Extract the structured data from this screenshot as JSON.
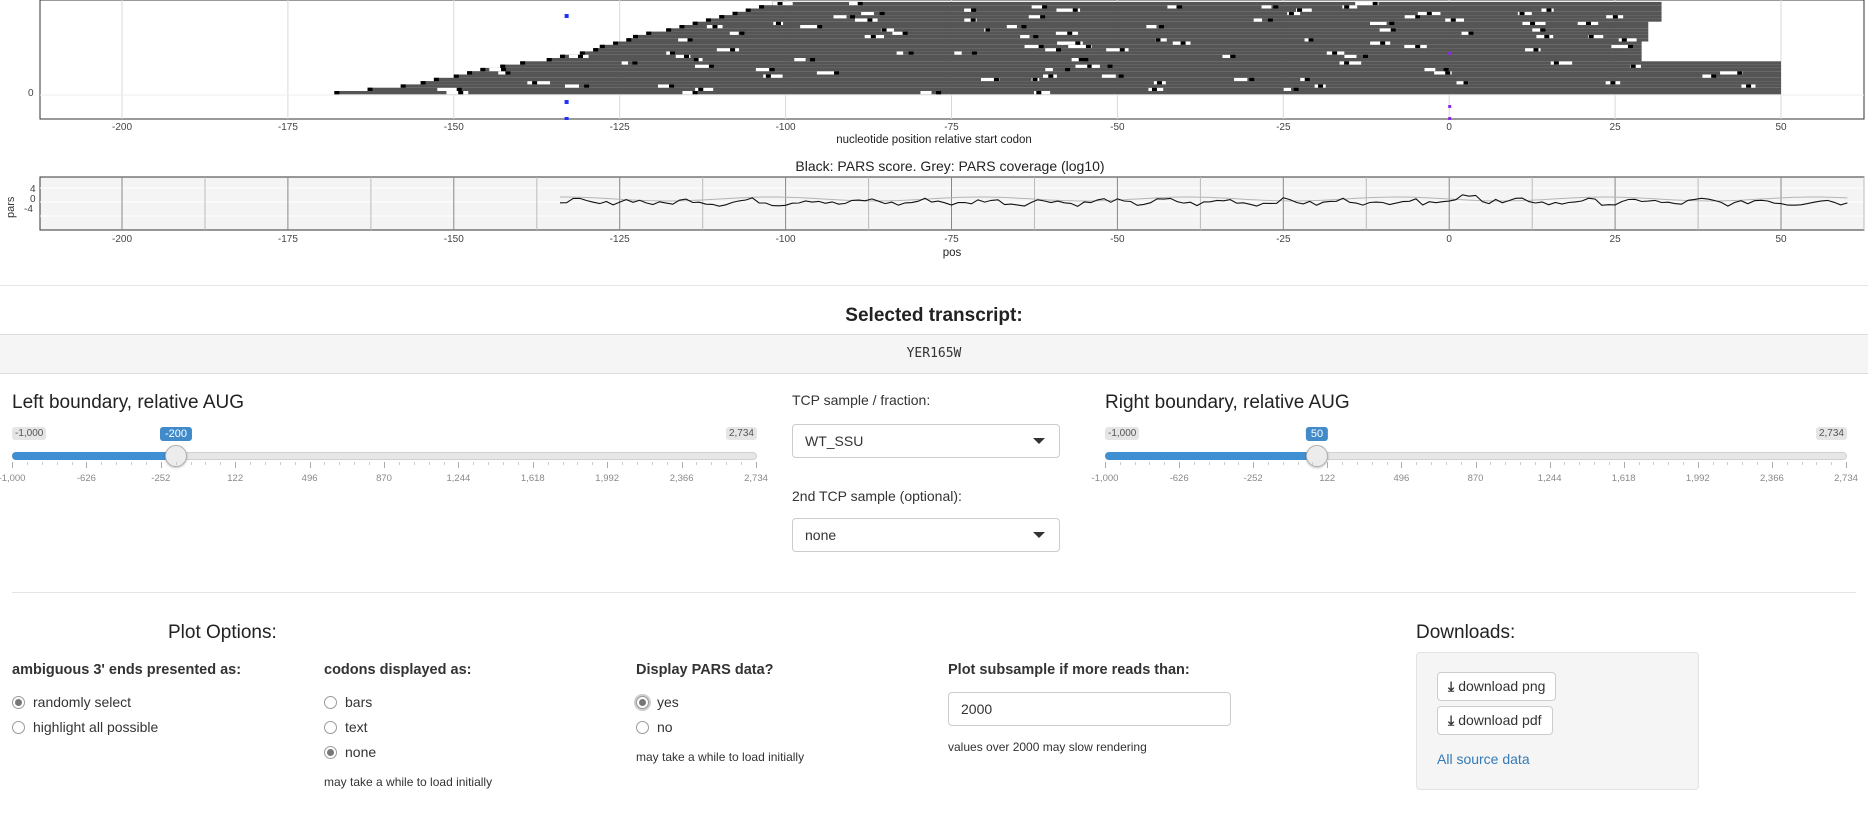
{
  "plot_top": {
    "x_ticks": [
      "-200",
      "-175",
      "-150",
      "-125",
      "-100",
      "-75",
      "-50",
      "-25",
      "0",
      "25",
      "50"
    ],
    "y_ticks": [
      "0"
    ],
    "xlabel": "nucleotide position relative start codon"
  },
  "pars_plot": {
    "title": "Black: PARS score. Grey: PARS coverage (log10)",
    "ylabel": "pars",
    "y_ticks": [
      "4",
      "0",
      "-4"
    ],
    "x_ticks": [
      "-200",
      "-175",
      "-150",
      "-125",
      "-100",
      "-75",
      "-50",
      "-25",
      "0",
      "25",
      "50"
    ],
    "xlabel": "pos"
  },
  "transcript": {
    "heading": "Selected transcript:",
    "value": "YER165W"
  },
  "left_slider": {
    "title": "Left boundary, relative AUG",
    "min": "-1,000",
    "max": "2,734",
    "value": "-200",
    "value_num": -200,
    "grid": [
      "-1,000",
      "-626",
      "-252",
      "122",
      "496",
      "870",
      "1,244",
      "1,618",
      "1,992",
      "2,366",
      "2,734"
    ]
  },
  "tcp": {
    "sample_label": "TCP sample / fraction:",
    "sample_value": "WT_SSU",
    "second_label": "2nd TCP sample (optional):",
    "second_value": "none"
  },
  "right_slider": {
    "title": "Right boundary, relative AUG",
    "min": "-1,000",
    "max": "2,734",
    "value": "50",
    "value_num": 50,
    "grid": [
      "-1,000",
      "-626",
      "-252",
      "122",
      "496",
      "870",
      "1,244",
      "1,618",
      "1,992",
      "2,366",
      "2,734"
    ]
  },
  "plot_options": {
    "heading": "Plot Options:",
    "ambiguous": {
      "label": "ambiguous 3' ends presented as:",
      "options": [
        "randomly select",
        "highlight all possible"
      ],
      "selected": 0
    },
    "codons": {
      "label": "codons displayed as:",
      "options": [
        "bars",
        "text",
        "none"
      ],
      "selected": 2,
      "help": "may take a while to load initially"
    },
    "pars": {
      "label": "Display PARS data?",
      "options": [
        "yes",
        "no"
      ],
      "selected": 0,
      "help": "may take a while to load initially"
    },
    "subsample": {
      "label": "Plot subsample if more reads than:",
      "value": "2000",
      "help": "values over 2000 may slow rendering"
    }
  },
  "downloads": {
    "heading": "Downloads:",
    "png": "download png",
    "pdf": "download pdf",
    "source_link": "All source data"
  },
  "colors": {
    "accent": "#3f8fd2",
    "bars": "#555555",
    "link": "#337ab7"
  }
}
